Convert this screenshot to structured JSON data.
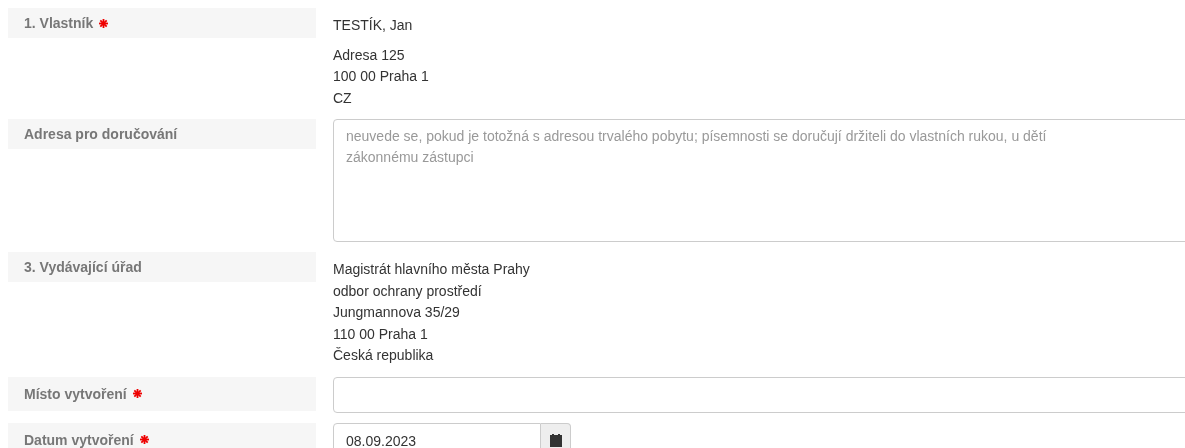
{
  "fields": [
    {
      "kind": "static",
      "label": "1. Vlastník",
      "required": true,
      "paragraphs": [
        [
          "TESTÍK, Jan"
        ],
        [
          "Adresa 125",
          "100 00 Praha 1",
          "CZ"
        ]
      ]
    },
    {
      "kind": "textarea",
      "label": "Adresa pro doručování",
      "required": false,
      "placeholder": "neuvede se, pokud je totožná s adresou trvalého pobytu; písemnosti se doručují držiteli do vlastních rukou, u dětí zákonnému zástupci"
    },
    {
      "kind": "static",
      "label": "3. Vydávající úřad",
      "required": false,
      "paragraphs": [
        [
          "Magistrát hlavního města Prahy",
          "odbor ochrany prostředí",
          "Jungmannova 35/29",
          "110 00 Praha 1",
          "Česká republika"
        ]
      ]
    },
    {
      "kind": "input",
      "label": "Místo vytvoření",
      "required": true
    },
    {
      "kind": "date",
      "label": "Datum vytvoření",
      "required": true,
      "value": "08.09.2023"
    }
  ]
}
